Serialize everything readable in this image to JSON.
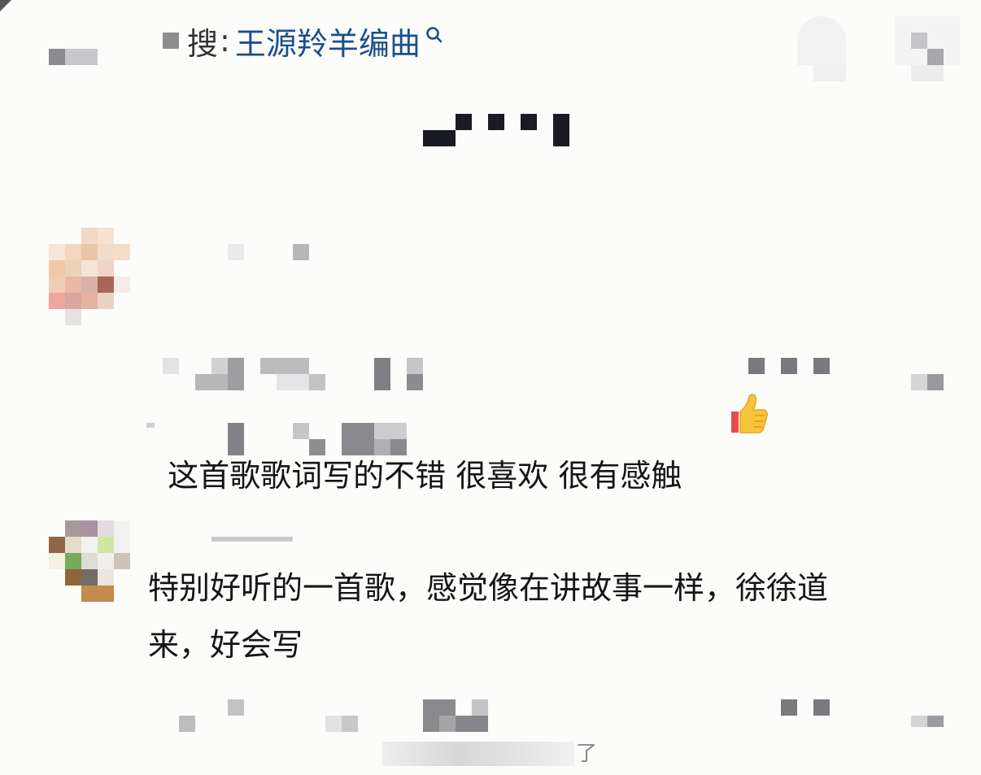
{
  "header": {
    "search_prefix": "搜",
    "search_separator": ":",
    "search_query": "王源羚羊编曲"
  },
  "comments": [
    {
      "text": "这首歌歌词写的不错 很喜欢 很有感触",
      "emoji": "thumbs-up-icon"
    },
    {
      "text": "特别好听的一首歌，感觉像在讲故事一样，徐徐道\n来，好会写"
    }
  ],
  "footer": {
    "reply_tail": "了"
  },
  "colors": {
    "background": "#fcfcfa",
    "query_link": "#1b4f8c",
    "text": "#151515"
  }
}
